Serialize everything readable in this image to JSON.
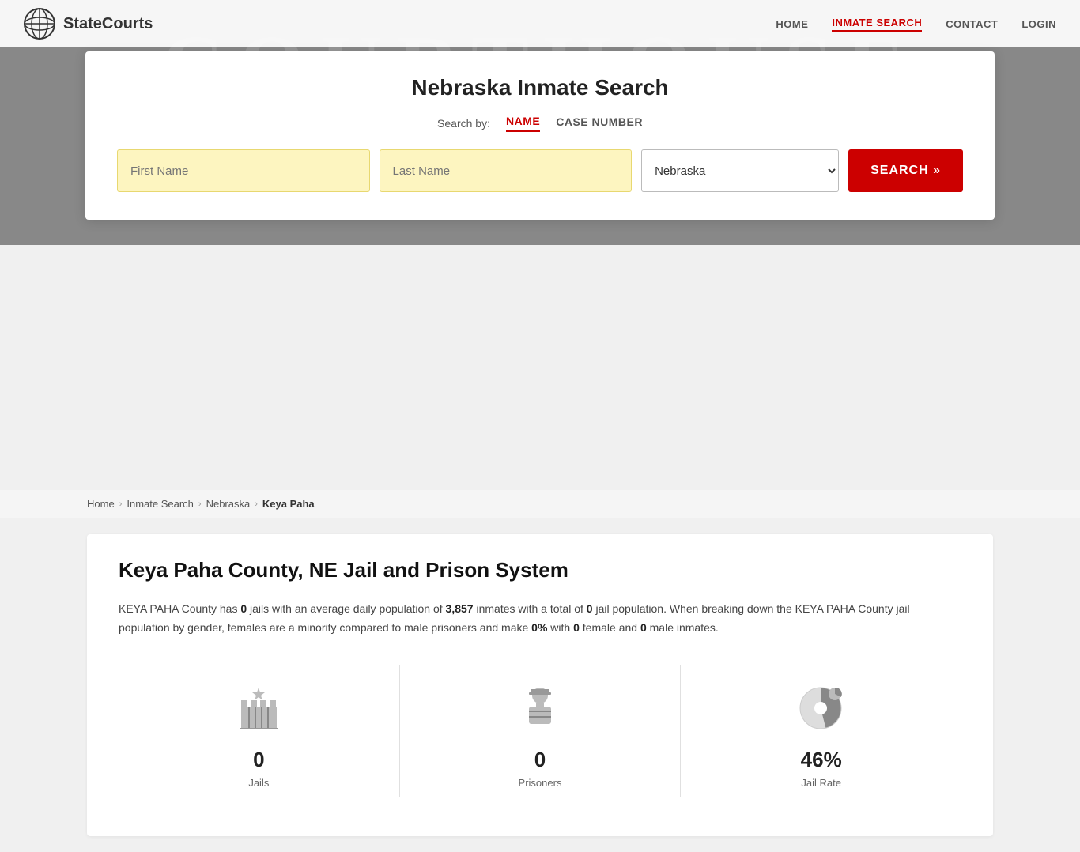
{
  "site": {
    "logo_text": "StateCourts",
    "logo_icon": "⚖"
  },
  "nav": {
    "links": [
      {
        "id": "home",
        "label": "HOME",
        "active": false
      },
      {
        "id": "inmate-search",
        "label": "INMATE SEARCH",
        "active": true
      },
      {
        "id": "contact",
        "label": "CONTACT",
        "active": false
      },
      {
        "id": "login",
        "label": "LOGIN",
        "active": false
      }
    ]
  },
  "header_bg_text": "COURTHOUSE",
  "search_card": {
    "title": "Nebraska Inmate Search",
    "search_by_label": "Search by:",
    "tabs": [
      {
        "id": "name",
        "label": "NAME",
        "active": true
      },
      {
        "id": "case-number",
        "label": "CASE NUMBER",
        "active": false
      }
    ],
    "first_name_placeholder": "First Name",
    "last_name_placeholder": "Last Name",
    "state_value": "Nebraska",
    "state_options": [
      "Nebraska"
    ],
    "search_button_label": "SEARCH »"
  },
  "breadcrumb": {
    "items": [
      {
        "label": "Home",
        "link": true
      },
      {
        "label": "Inmate Search",
        "link": true
      },
      {
        "label": "Nebraska",
        "link": true
      },
      {
        "label": "Keya Paha",
        "link": false
      }
    ]
  },
  "main": {
    "county_title": "Keya Paha County, NE Jail and Prison System",
    "description_parts": {
      "prefix": "KEYA PAHA County has ",
      "jails_count": "0",
      "middle1": " jails with an average daily population of ",
      "avg_population": "3,857",
      "middle2": " inmates with a total of ",
      "total_pop": "0",
      "middle3": " jail population. When breaking down the KEYA PAHA County jail population by gender, females are a minority compared to male prisoners and make ",
      "female_pct": "0%",
      "middle4": " with ",
      "female_count": "0",
      "middle5": " female and ",
      "male_count": "0",
      "suffix": " male inmates."
    },
    "stats": [
      {
        "id": "jails",
        "icon_type": "jail-building",
        "number": "0",
        "label": "Jails"
      },
      {
        "id": "prisoners",
        "icon_type": "prisoner",
        "number": "0",
        "label": "Prisoners"
      },
      {
        "id": "jail-rate",
        "icon_type": "pie-chart",
        "number": "46%",
        "label": "Jail Rate"
      }
    ]
  }
}
